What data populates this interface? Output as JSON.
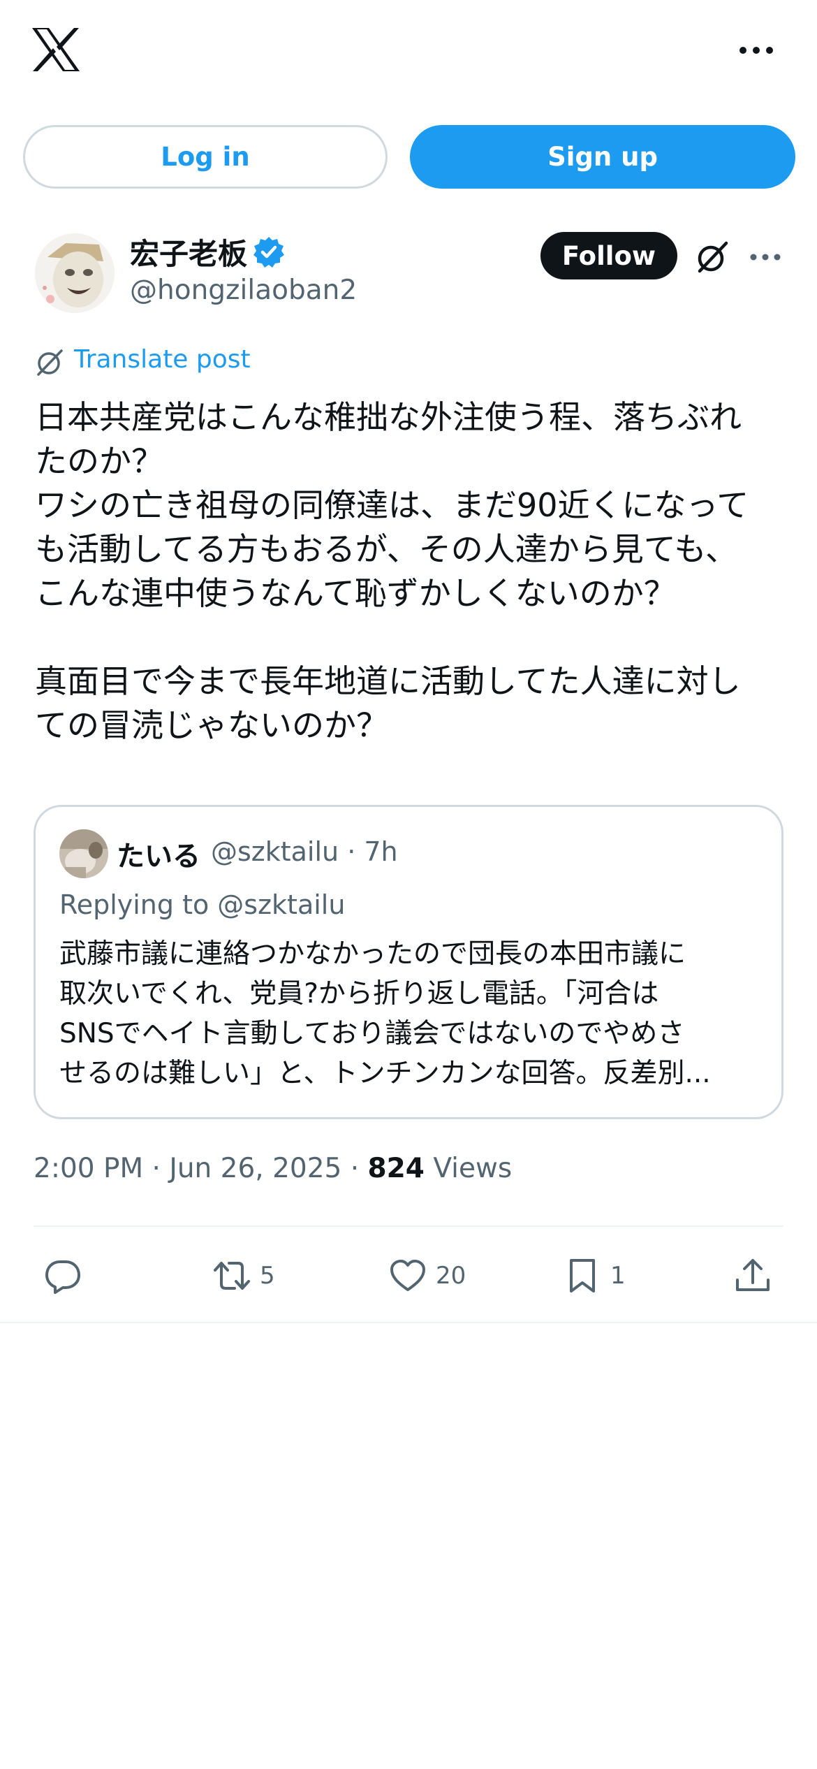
{
  "header": {
    "logo_icon": "x-logo-icon",
    "more_icon": "more-horizontal-icon"
  },
  "auth": {
    "login_label": "Log in",
    "signup_label": "Sign up"
  },
  "post": {
    "author": {
      "name": "宏子老板",
      "handle": "@hongzilaoban2",
      "verified": true
    },
    "follow_label": "Follow",
    "translate_label": "Translate post",
    "text_lines": [
      "日本共産党はこんな稚拙な外注使う程、落ちぶれ",
      "たのか？",
      "ワシの亡き祖母の同僚達は、まだ90近くになって",
      "も活動してる方もおるが、その人達から見ても、",
      "こんな連中使うなんて恥ずかしくないのか？",
      "",
      "真面目で今まで長年地道に活動してた人達に対し",
      "ての冒涜じゃないのか？"
    ],
    "quote": {
      "name": "たいる",
      "handle_time": "@szktailu · 7h",
      "replying": "Replying to @szktailu",
      "text_lines": [
        "武藤市議に連絡つかなかったので団長の本田市議に",
        "取次いでくれ、党員?から折り返し電話。「河合は",
        "SNSでヘイト言動しており議会ではないのでやめさ",
        "せるのは難しい」と、トンチンカンな回答。反差別..."
      ]
    },
    "meta": {
      "time_date": "2:00 PM · Jun 26, 2025 · ",
      "views_count": "824",
      "views_label": " Views"
    },
    "actions": {
      "replies": "",
      "reposts": "5",
      "likes": "20",
      "bookmarks": "1"
    }
  },
  "colors": {
    "accent": "#1d9bf0",
    "text": "#0f1419",
    "muted": "#536471",
    "border": "#cfd9de"
  }
}
